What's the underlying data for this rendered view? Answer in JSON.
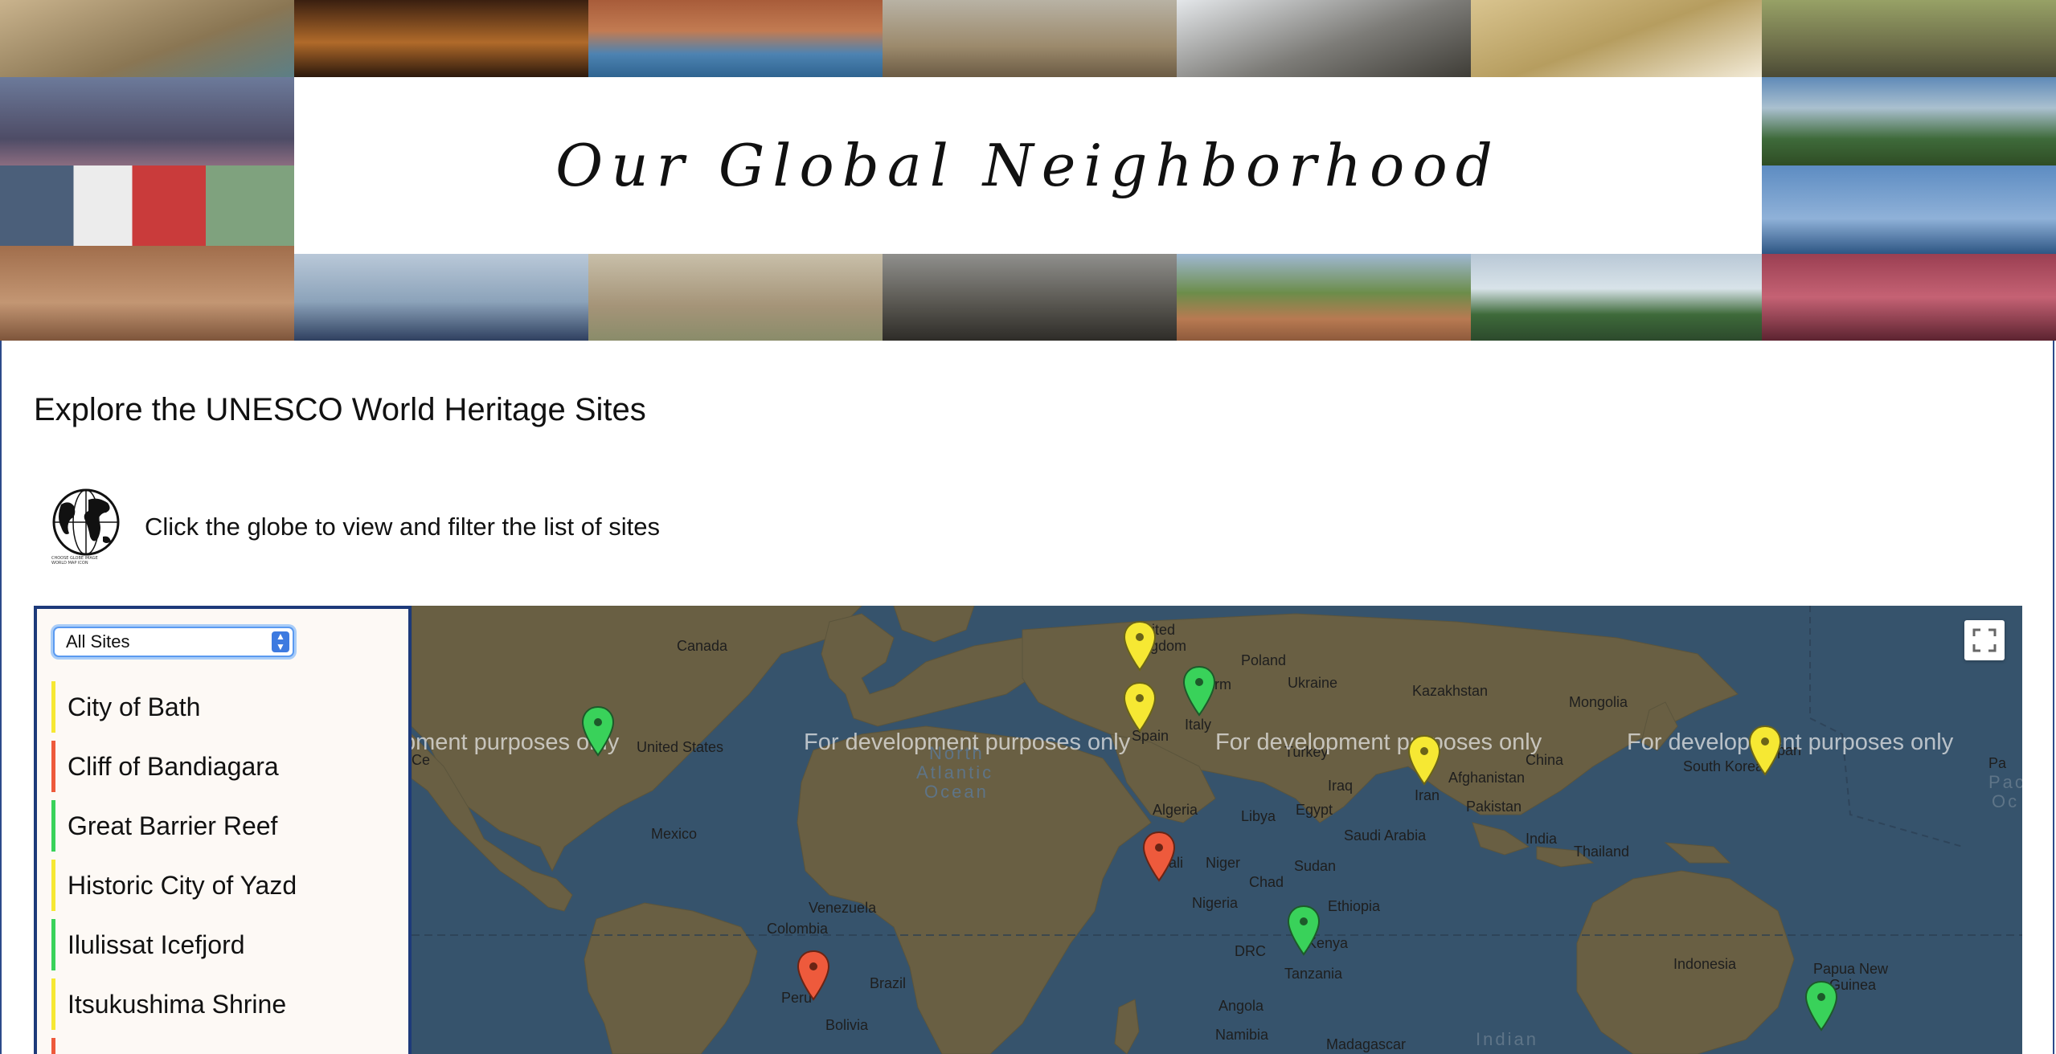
{
  "header": {
    "title": "Our Global Neighborhood"
  },
  "intro": {
    "heading": "Explore the UNESCO World Heritage Sites",
    "globe_caption_lines": [
      "CHOOSE GLOBE IMAGE",
      "WORLD MAP ICON"
    ],
    "hint": "Click the globe to view and filter the list of sites"
  },
  "filter": {
    "selected": "All Sites"
  },
  "sites": [
    {
      "name": "City of Bath",
      "color": "#f6e833"
    },
    {
      "name": "Cliff of Bandiagara",
      "color": "#ee5a3c"
    },
    {
      "name": "Great Barrier Reef",
      "color": "#39d25a"
    },
    {
      "name": "Historic City of Yazd",
      "color": "#f6e833"
    },
    {
      "name": "Ilulissat Icefjord",
      "color": "#39d25a"
    },
    {
      "name": "Itsukushima Shrine",
      "color": "#f6e833"
    },
    {
      "name": "",
      "color": "#ee5a3c"
    }
  ],
  "map": {
    "watermark": "For development purposes only",
    "labels": [
      "Canada",
      "United",
      "Kingdom",
      "Poland",
      "Germ",
      "Ukraine",
      "Kazakhstan",
      "Mongolia",
      "United States",
      "Spain",
      "Italy",
      "Turkey",
      "China",
      "South Korea",
      "Japan",
      "Iraq",
      "Afghanistan",
      "Iran",
      "Pakistan",
      "Algeria",
      "Libya",
      "Egypt",
      "Saudi Arabia",
      "India",
      "Mexico",
      "Mali",
      "Niger",
      "Chad",
      "Sudan",
      "Thailand",
      "Nigeria",
      "Ethiopia",
      "Venezuela",
      "Colombia",
      "Kenya",
      "DRC",
      "Tanzania",
      "Indonesia",
      "Brazil",
      "Peru",
      "Bolivia",
      "Angola",
      "Papua New",
      "Guinea",
      "Namibia",
      "Madagascar",
      "Ce",
      "Pa"
    ],
    "oceans": [
      "North",
      "Atlantic",
      "Ocean",
      "Indian",
      "Pac",
      "Oc"
    ],
    "colors": {
      "water": "#3c5b74",
      "land": "#7a6a43",
      "pin_green": "#39d25a",
      "pin_yellow": "#f6e833",
      "pin_red": "#ee5a3c"
    }
  },
  "icons": {
    "globe": "globe-icon",
    "fullscreen": "fullscreen-icon",
    "select": "chevron-updown-icon",
    "pin": "map-pin-icon"
  }
}
